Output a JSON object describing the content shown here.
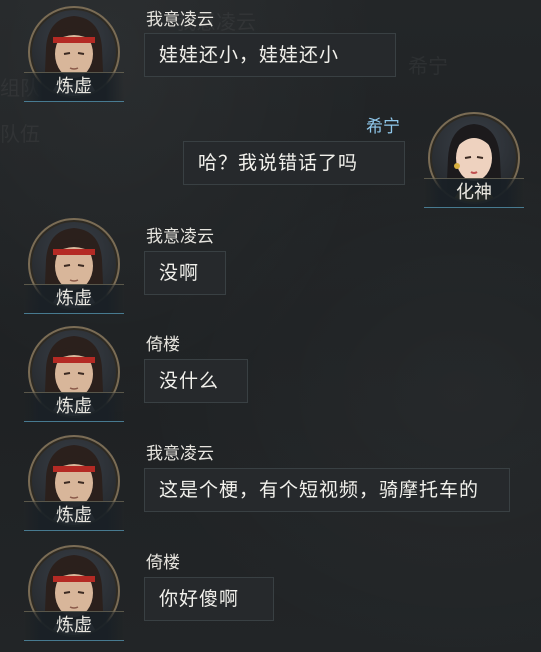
{
  "background_ghost_text": [
    "我意凌云",
    "组队",
    "队伍",
    "希宁"
  ],
  "messages": [
    {
      "sender": "我意凌云",
      "rank": "炼虚",
      "text": "娃娃还小，娃娃还小",
      "side": "left",
      "avatar": "male-red-headband-portrait"
    },
    {
      "sender": "希宁",
      "rank": "化神",
      "text": "哈？我说错话了吗",
      "side": "right",
      "avatar": "female-portrait"
    },
    {
      "sender": "我意凌云",
      "rank": "炼虚",
      "text": "没啊",
      "side": "left",
      "avatar": "male-red-headband-portrait"
    },
    {
      "sender": "倚楼",
      "rank": "炼虚",
      "text": "没什么",
      "side": "left",
      "avatar": "male-red-headband-portrait"
    },
    {
      "sender": "我意凌云",
      "rank": "炼虚",
      "text": "这是个梗，有个短视频，骑摩托车的",
      "side": "left",
      "avatar": "male-red-headband-portrait"
    },
    {
      "sender": "倚楼",
      "rank": "炼虚",
      "text": "你好傻啊",
      "side": "left",
      "avatar": "male-red-headband-portrait"
    }
  ],
  "colors": {
    "background": "#202325",
    "bubble": "#262a2d",
    "self_name": "#8fc7ea",
    "other_name": "#e6e4de",
    "avatar_ring": "#7a6c55"
  }
}
